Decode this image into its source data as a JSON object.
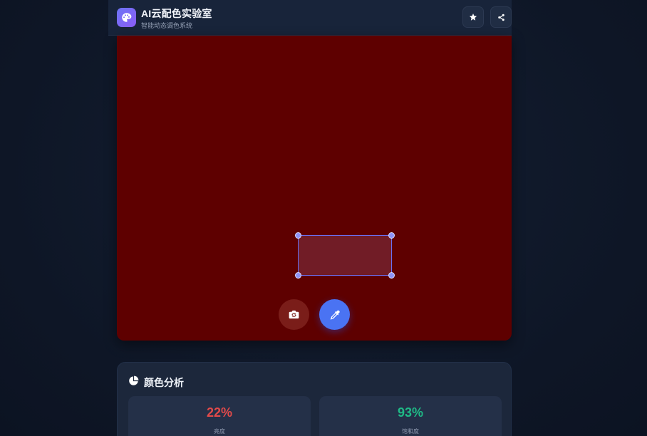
{
  "header": {
    "title": "AI云配色实验室",
    "subtitle": "智能动态调色系统",
    "favorite_icon": "star-icon",
    "share_icon": "share-icon",
    "logo_icon": "palette-icon"
  },
  "preview": {
    "sampled_color": "#5e0000",
    "switch_camera_icon": "camera-rotate-icon",
    "color_picker_icon": "eyedropper-icon"
  },
  "analysis": {
    "title": "颜色分析",
    "icon": "pie-chart-icon",
    "stats": [
      {
        "value": "22%",
        "label": "亮度",
        "color": "#e14a4a"
      },
      {
        "value": "93%",
        "label": "饱和度",
        "color": "#1fb986"
      }
    ]
  },
  "colors": {
    "accent": "#4a73f3",
    "logo_gradient_start": "#6d74f5",
    "logo_gradient_end": "#8b5cf6"
  }
}
